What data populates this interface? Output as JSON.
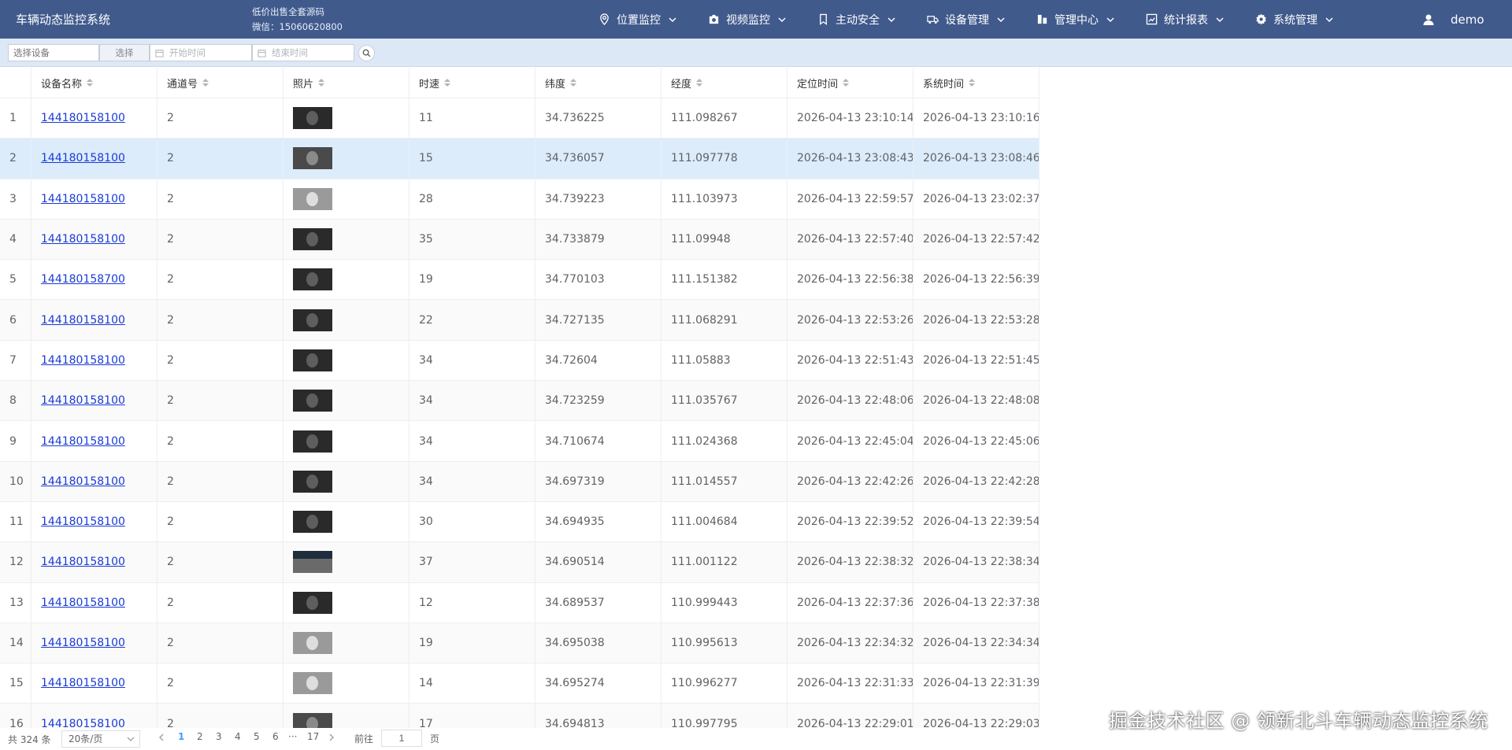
{
  "header": {
    "app_title": "车辆动态监控系统",
    "promo_line1": "低价出售全套源码",
    "promo_line2": "微信：15060620800",
    "nav": [
      {
        "label": "位置监控",
        "icon": "location-icon"
      },
      {
        "label": "视频监控",
        "icon": "camera-icon"
      },
      {
        "label": "主动安全",
        "icon": "bookmark-icon"
      },
      {
        "label": "设备管理",
        "icon": "truck-icon"
      },
      {
        "label": "管理中心",
        "icon": "building-icon"
      },
      {
        "label": "统计报表",
        "icon": "chart-icon"
      },
      {
        "label": "系统管理",
        "icon": "gear-icon"
      }
    ],
    "user": "demo"
  },
  "filter": {
    "device_placeholder": "选择设备",
    "select_label": "选择",
    "start_placeholder": "开始时间",
    "end_placeholder": "结束时间"
  },
  "table": {
    "columns": [
      "设备名称",
      "通道号",
      "照片",
      "时速",
      "纬度",
      "经度",
      "定位时间",
      "系统时间"
    ],
    "rows": [
      {
        "no": "1",
        "device": "144180158100",
        "channel": "2",
        "speed": "11",
        "lat": "34.736225",
        "lng": "111.098267",
        "loc_time": "2026-04-13 23:10:14",
        "sys_time": "2026-04-13 23:10:16"
      },
      {
        "no": "2",
        "device": "144180158100",
        "channel": "2",
        "speed": "15",
        "lat": "34.736057",
        "lng": "111.097778",
        "loc_time": "2026-04-13 23:08:43",
        "sys_time": "2026-04-13 23:08:46"
      },
      {
        "no": "3",
        "device": "144180158100",
        "channel": "2",
        "speed": "28",
        "lat": "34.739223",
        "lng": "111.103973",
        "loc_time": "2026-04-13 22:59:57",
        "sys_time": "2026-04-13 23:02:37"
      },
      {
        "no": "4",
        "device": "144180158100",
        "channel": "2",
        "speed": "35",
        "lat": "34.733879",
        "lng": "111.09948",
        "loc_time": "2026-04-13 22:57:40",
        "sys_time": "2026-04-13 22:57:42"
      },
      {
        "no": "5",
        "device": "144180158700",
        "channel": "2",
        "speed": "19",
        "lat": "34.770103",
        "lng": "111.151382",
        "loc_time": "2026-04-13 22:56:38",
        "sys_time": "2026-04-13 22:56:39"
      },
      {
        "no": "6",
        "device": "144180158100",
        "channel": "2",
        "speed": "22",
        "lat": "34.727135",
        "lng": "111.068291",
        "loc_time": "2026-04-13 22:53:26",
        "sys_time": "2026-04-13 22:53:28"
      },
      {
        "no": "7",
        "device": "144180158100",
        "channel": "2",
        "speed": "34",
        "lat": "34.72604",
        "lng": "111.05883",
        "loc_time": "2026-04-13 22:51:43",
        "sys_time": "2026-04-13 22:51:45"
      },
      {
        "no": "8",
        "device": "144180158100",
        "channel": "2",
        "speed": "34",
        "lat": "34.723259",
        "lng": "111.035767",
        "loc_time": "2026-04-13 22:48:06",
        "sys_time": "2026-04-13 22:48:08"
      },
      {
        "no": "9",
        "device": "144180158100",
        "channel": "2",
        "speed": "34",
        "lat": "34.710674",
        "lng": "111.024368",
        "loc_time": "2026-04-13 22:45:04",
        "sys_time": "2026-04-13 22:45:06"
      },
      {
        "no": "10",
        "device": "144180158100",
        "channel": "2",
        "speed": "34",
        "lat": "34.697319",
        "lng": "111.014557",
        "loc_time": "2026-04-13 22:42:26",
        "sys_time": "2026-04-13 22:42:28"
      },
      {
        "no": "11",
        "device": "144180158100",
        "channel": "2",
        "speed": "30",
        "lat": "34.694935",
        "lng": "111.004684",
        "loc_time": "2026-04-13 22:39:52",
        "sys_time": "2026-04-13 22:39:54"
      },
      {
        "no": "12",
        "device": "144180158100",
        "channel": "2",
        "speed": "37",
        "lat": "34.690514",
        "lng": "111.001122",
        "loc_time": "2026-04-13 22:38:32",
        "sys_time": "2026-04-13 22:38:34"
      },
      {
        "no": "13",
        "device": "144180158100",
        "channel": "2",
        "speed": "12",
        "lat": "34.689537",
        "lng": "110.999443",
        "loc_time": "2026-04-13 22:37:36",
        "sys_time": "2026-04-13 22:37:38"
      },
      {
        "no": "14",
        "device": "144180158100",
        "channel": "2",
        "speed": "19",
        "lat": "34.695038",
        "lng": "110.995613",
        "loc_time": "2026-04-13 22:34:32",
        "sys_time": "2026-04-13 22:34:34"
      },
      {
        "no": "15",
        "device": "144180158100",
        "channel": "2",
        "speed": "14",
        "lat": "34.695274",
        "lng": "110.996277",
        "loc_time": "2026-04-13 22:31:33",
        "sys_time": "2026-04-13 22:31:39"
      },
      {
        "no": "16",
        "device": "144180158100",
        "channel": "2",
        "speed": "17",
        "lat": "34.694813",
        "lng": "110.997795",
        "loc_time": "2026-04-13 22:29:01",
        "sys_time": "2026-04-13 22:29:03"
      }
    ]
  },
  "pager": {
    "total": "共 324 条",
    "page_size": "20条/页",
    "pages": [
      "1",
      "2",
      "3",
      "4",
      "5",
      "6",
      "17"
    ],
    "ellipsis": "···",
    "goto": "前往",
    "goto_value": "1",
    "page_unit": "页"
  },
  "watermark": "掘金技术社区 @ 领新北斗车辆动态监控系统"
}
